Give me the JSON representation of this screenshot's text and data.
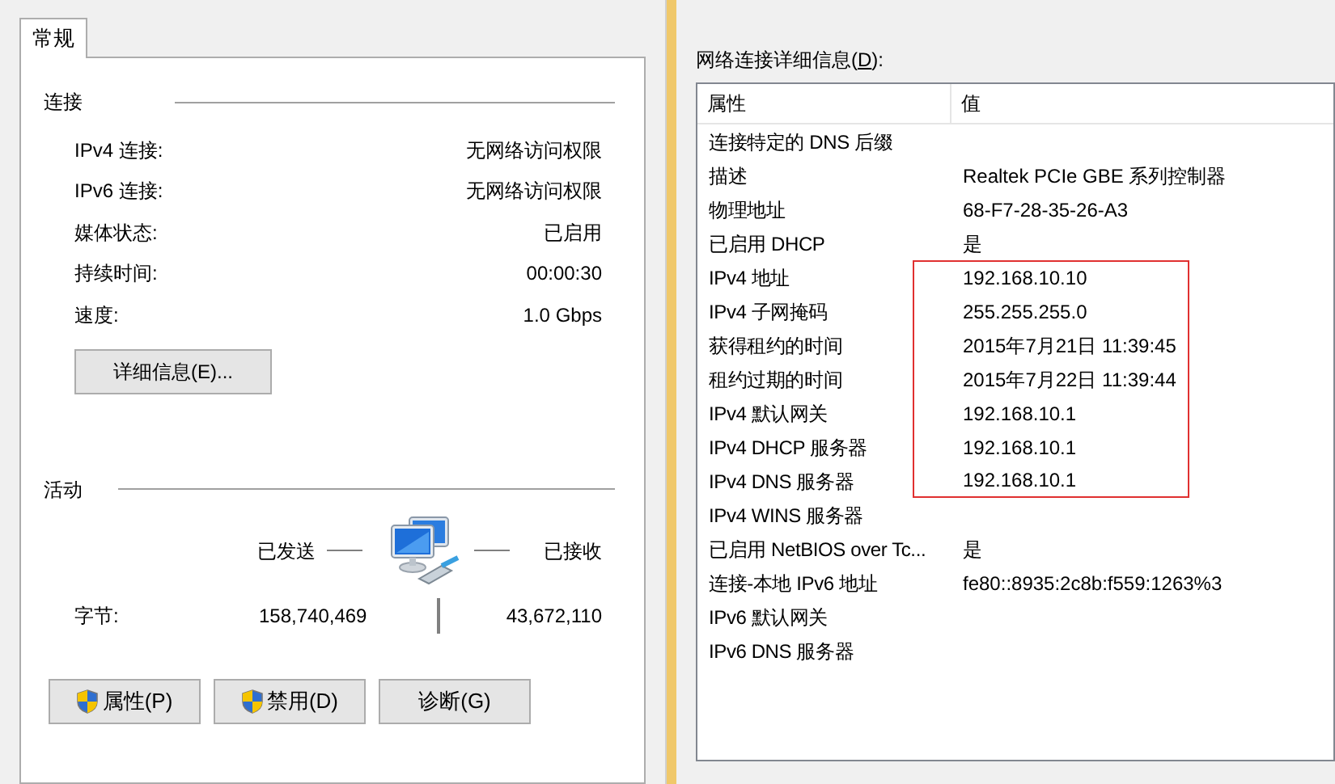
{
  "tabs": [
    {
      "label": "常规",
      "selected": true
    }
  ],
  "connection": {
    "heading": "连接",
    "rows": [
      {
        "label": "IPv4 连接:",
        "value": "无网络访问权限"
      },
      {
        "label": "IPv6 连接:",
        "value": "无网络访问权限"
      },
      {
        "label": "媒体状态:",
        "value": "已启用"
      },
      {
        "label": "持续时间:",
        "value": "00:00:30"
      },
      {
        "label": "速度:",
        "value": "1.0 Gbps"
      }
    ],
    "details_button": "详细信息(E)..."
  },
  "activity": {
    "heading": "活动",
    "sent_label": "已发送",
    "received_label": "已接收",
    "bytes_label": "字节:",
    "sent": "158,740,469",
    "received": "43,672,110"
  },
  "buttons": [
    {
      "label": "属性(P)",
      "shield": true
    },
    {
      "label": "禁用(D)",
      "shield": true
    },
    {
      "label": "诊断(G)",
      "shield": false
    }
  ],
  "details": {
    "label": "网络连接详细信息(",
    "mnemonic": "D",
    "label_end": "):",
    "columns": [
      "属性",
      "值"
    ],
    "rows": [
      {
        "property": "连接特定的 DNS 后缀",
        "highlighted": false
      },
      {
        "property": "描述",
        "value": "Realtek PCIe GBE 系列控制器",
        "highlighted": false
      },
      {
        "property": "物理地址",
        "value": "68-F7-28-35-26-A3",
        "highlighted": false
      },
      {
        "property": "已启用 DHCP",
        "value": "是",
        "highlighted": false
      },
      {
        "property": "IPv4 地址",
        "value": "192.168.10.10",
        "highlighted": true
      },
      {
        "property": "IPv4 子网掩码",
        "value": "255.255.255.0",
        "highlighted": true
      },
      {
        "property": "获得租约的时间",
        "value": "2015年7月21日 11:39:45",
        "highlighted": true
      },
      {
        "property": "租约过期的时间",
        "value": "2015年7月22日 11:39:44",
        "highlighted": true
      },
      {
        "property": "IPv4 默认网关",
        "value": "192.168.10.1",
        "highlighted": true
      },
      {
        "property": "IPv4 DHCP 服务器",
        "value": "192.168.10.1",
        "highlighted": true
      },
      {
        "property": "IPv4 DNS 服务器",
        "value": "192.168.10.1",
        "highlighted": true
      },
      {
        "property": "IPv4 WINS 服务器",
        "highlighted": false
      },
      {
        "property": "已启用 NetBIOS over Tc...",
        "value": "是",
        "highlighted": false
      },
      {
        "property": "连接-本地 IPv6 地址",
        "value": "fe80::8935:2c8b:f559:1263%3",
        "highlighted": false
      },
      {
        "property": "IPv6 默认网关",
        "highlighted": false
      },
      {
        "property": "IPv6 DNS 服务器",
        "highlighted": false
      }
    ]
  }
}
